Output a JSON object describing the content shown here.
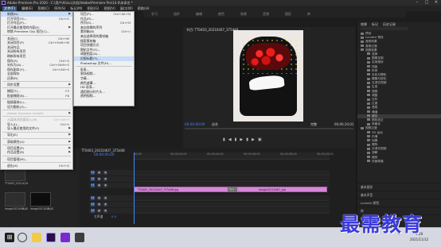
{
  "title_bar": {
    "title": "Adobe Premiere Pro 2020 - C:\\用户\\Ai\\icu\\文档\\Adobe\\Premiere Pro\\14.0\\未命名 *"
  },
  "menu_bar": [
    "文件(F)",
    "编辑(E)",
    "剪辑(C)",
    "序列(S)",
    "标记(M)",
    "图形(G)",
    "视图(V)",
    "窗口(W)",
    "帮助(H)"
  ],
  "workspaces": [
    "学习",
    "组件",
    "编辑",
    "颜色",
    "效果",
    "音频",
    "图形",
    "库"
  ],
  "file_menu": [
    {
      "label": "新建(N)",
      "shortcut": "",
      "submenu": true,
      "highlight": true
    },
    {
      "label": "打开项目(O)...",
      "shortcut": "Ctrl+O"
    },
    {
      "label": "打开作品(P)...",
      "shortcut": ""
    },
    {
      "label": "打开最近使用的内容(E)",
      "shortcut": "",
      "submenu": true
    },
    {
      "label": "转换 Premiere Clip 项目(C)...",
      "shortcut": ""
    },
    {
      "sep": true
    },
    {
      "label": "关闭(C)",
      "shortcut": "Ctrl+W"
    },
    {
      "label": "关闭项目(P)",
      "shortcut": "Ctrl+Shift+W"
    },
    {
      "label": "关闭作品",
      "shortcut": ""
    },
    {
      "label": "关闭所有项目",
      "shortcut": ""
    },
    {
      "label": "刷新所有项目",
      "shortcut": ""
    },
    {
      "label": "保存(S)",
      "shortcut": "Ctrl+S"
    },
    {
      "label": "另存为(A)...",
      "shortcut": "Ctrl+Shift+S"
    },
    {
      "label": "保存副本(Y)...",
      "shortcut": "Ctrl+Alt+S"
    },
    {
      "label": "全部保存",
      "shortcut": ""
    },
    {
      "label": "还原(R)",
      "shortcut": ""
    },
    {
      "sep": true
    },
    {
      "label": "同步设置",
      "shortcut": "",
      "submenu": true
    },
    {
      "sep": true
    },
    {
      "label": "捕捉(T)...",
      "shortcut": "F5"
    },
    {
      "label": "批量捕捉(B)...",
      "shortcut": "F6"
    },
    {
      "sep": true
    },
    {
      "label": "链接媒体(L)...",
      "shortcut": ""
    },
    {
      "label": "设为脱机(O)...",
      "shortcut": ""
    },
    {
      "sep": true
    },
    {
      "label": "Adobe Dynamic Link(K)",
      "shortcut": "",
      "submenu": true,
      "disabled": true
    },
    {
      "sep": true
    },
    {
      "label": "从媒体浏览器导入(M)",
      "shortcut": "Ctrl+Alt+I",
      "disabled": true
    },
    {
      "label": "导入(I)...",
      "shortcut": "Ctrl+I"
    },
    {
      "label": "导入最近使用的文件(F)",
      "shortcut": "",
      "submenu": true
    },
    {
      "sep": true
    },
    {
      "label": "导出(E)",
      "shortcut": "",
      "submenu": true
    },
    {
      "sep": true
    },
    {
      "label": "获取属性(G)",
      "shortcut": "",
      "submenu": true
    },
    {
      "sep": true
    },
    {
      "label": "项目设置(P)",
      "shortcut": "",
      "submenu": true
    },
    {
      "label": "作品设置(R)",
      "shortcut": "",
      "submenu": true
    },
    {
      "sep": true
    },
    {
      "label": "项目管理(M)...",
      "shortcut": ""
    },
    {
      "sep": true
    },
    {
      "label": "退出(X)",
      "shortcut": "Ctrl+Q"
    }
  ],
  "new_submenu": [
    {
      "label": "项目(P)...",
      "shortcut": "Ctrl+Alt+N"
    },
    {
      "label": "作品(R)...",
      "shortcut": ""
    },
    {
      "label": "序列(S)...",
      "shortcut": "Ctrl+N"
    },
    {
      "label": "来自剪辑的序列",
      "shortcut": ""
    },
    {
      "label": "素材箱(B)",
      "shortcut": "Ctrl+/"
    },
    {
      "label": "来自选择项的素材箱",
      "shortcut": ""
    },
    {
      "label": "搜索素材箱",
      "shortcut": ""
    },
    {
      "label": "项目快捷方式",
      "shortcut": ""
    },
    {
      "label": "脱机文件(O)...",
      "shortcut": ""
    },
    {
      "label": "调整图层(A)...",
      "shortcut": ""
    },
    {
      "label": "旧版标题(T)...",
      "shortcut": "",
      "highlight": true
    },
    {
      "label": "Photoshop 文件(H)...",
      "shortcut": ""
    },
    {
      "sep": true
    },
    {
      "label": "彩条...",
      "shortcut": ""
    },
    {
      "label": "黑场视频...",
      "shortcut": ""
    },
    {
      "label": "字幕...",
      "shortcut": ""
    },
    {
      "label": "颜色遮罩...",
      "shortcut": ""
    },
    {
      "label": "HD 彩条...",
      "shortcut": ""
    },
    {
      "label": "通用倒计时片头...",
      "shortcut": ""
    },
    {
      "label": "透明视频...",
      "shortcut": ""
    }
  ],
  "program_monitor": {
    "tab": "节目: TT0403_20210407_375d48",
    "timecode_left": "00;00;00;00",
    "fit": "适合",
    "quality": "完整",
    "timecode_right": "00;00;10;01"
  },
  "effects_panel": {
    "tabs": [
      "效果",
      "标记",
      "历史记录"
    ],
    "items": [
      "预设",
      "Lumetri 预设",
      "音频效果",
      "音频过渡",
      "视频效果",
      "变换",
      "图像控制",
      "实用程序",
      "扭曲",
      "时间",
      "杂色与颗粒",
      "模糊与锐化",
      "沉浸式视频",
      "生成",
      "视频",
      "调整",
      "过时",
      "过渡",
      "透视",
      "通道",
      "键控",
      "颜色校正",
      "风格化",
      "视频过渡",
      "3D 运动",
      "内滑",
      "划像",
      "擦除",
      "沉浸式视频",
      "溶解",
      "缩放",
      "页面剥落"
    ],
    "selected_index": 20,
    "lower": [
      "基本图形",
      "基本声音",
      "Lumetri 颜色",
      "库",
      "标记"
    ]
  },
  "timeline": {
    "tab": "TT0403_20210407_375d48",
    "timecode": "00;00;00;00",
    "ruler": [
      "00;00",
      "00;00;02;00",
      "00;00;04;00",
      "00;00;06;00",
      "00;00;08;00",
      "00;00;10;00"
    ],
    "video_tracks": [
      "V3",
      "V2",
      "V1"
    ],
    "audio_tracks": [
      "A1",
      "A2",
      "A3"
    ],
    "master": "主声道",
    "master_value": "0.0",
    "clip_left": "TT0403_20210407_375d48.jpg",
    "transition": "交叉溶解",
    "clip_right": "Image20210407_jpg"
  },
  "project_panel": {
    "items": [
      {
        "name": "TT0403_2021...",
        "dur": "4;29"
      },
      {
        "name": "Image2021040...",
        "dur": "5;00"
      },
      {
        "name": "Image2021040...",
        "dur": "5;00"
      }
    ]
  },
  "taskbar": {
    "time": "9:28",
    "date": "2021/11/12",
    "lang": "中"
  },
  "watermark": "最需教育"
}
